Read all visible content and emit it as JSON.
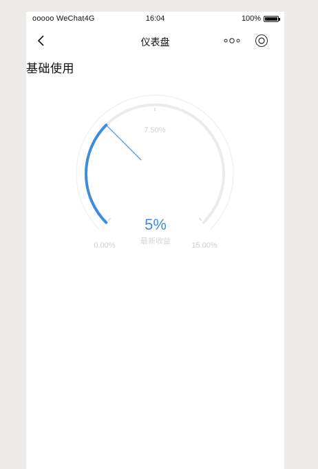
{
  "status_bar": {
    "carrier": "ooooo WeChat4G",
    "time": "16:04",
    "battery": "100%"
  },
  "nav": {
    "title": "仪表盘"
  },
  "section": {
    "title": "基础使用"
  },
  "gauge": {
    "value_text": "5%",
    "detail_text": "最新收益",
    "min": 0,
    "max": 15,
    "value": 5,
    "axis_labels": [
      "0.00%",
      "7.50%",
      "15.00%"
    ],
    "colors": {
      "progress": "#3c8ddf",
      "track": "#ebebeb",
      "pointer": "#5a8ec4",
      "label": "#cfcfcf"
    }
  }
}
